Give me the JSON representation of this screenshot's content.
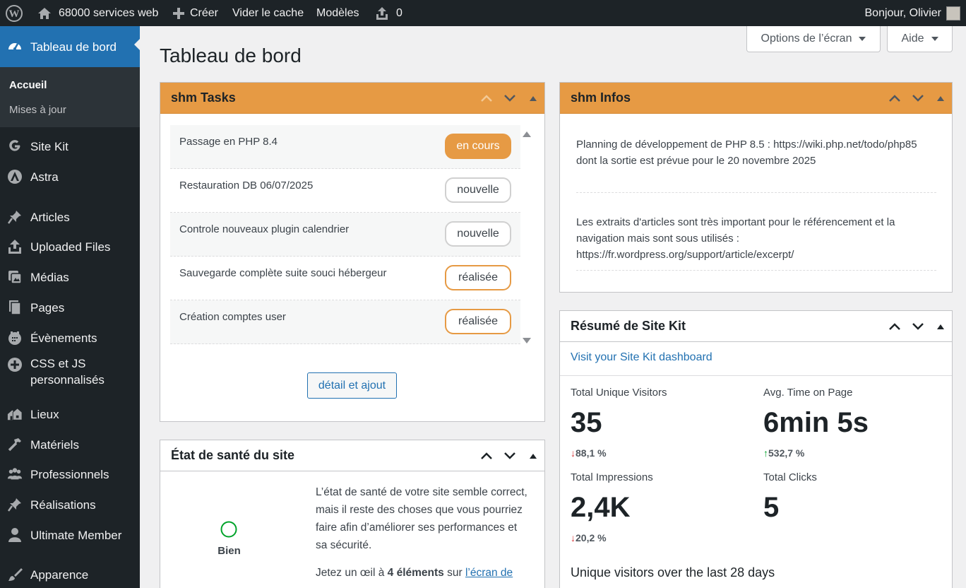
{
  "adminbar": {
    "site_name": "68000 services web",
    "create_label": "Créer",
    "clear_cache_label": "Vider le cache",
    "templates_label": "Modèles",
    "updates_count": "0",
    "greeting": "Bonjour, Olivier"
  },
  "sidebar": {
    "dashboard_label": "Tableau de bord",
    "submenu": [
      "Accueil",
      "Mises à jour"
    ],
    "items": [
      "Site Kit",
      "Astra",
      "Articles",
      "Uploaded Files",
      "Médias",
      "Pages",
      "Évènements",
      "CSS et JS personnalisés",
      "Lieux",
      "Matériels",
      "Professionnels",
      "Réalisations",
      "Ultimate Member",
      "Apparence"
    ]
  },
  "header": {
    "title": "Tableau de bord",
    "screen_options": "Options de l’écran",
    "help": "Aide"
  },
  "tasks": {
    "title": "shm Tasks",
    "items": [
      {
        "label": "Passage en PHP 8.4",
        "status": "en cours"
      },
      {
        "label": "Restauration DB 06/07/2025",
        "status": "nouvelle"
      },
      {
        "label": "Controle nouveaux plugin calendrier",
        "status": "nouvelle"
      },
      {
        "label": "Sauvegarde complète suite souci hébergeur",
        "status": "réalisée"
      },
      {
        "label": "Création comptes user",
        "status": "réalisée"
      }
    ],
    "button": "détail et ajout"
  },
  "health": {
    "title": "État de santé du site",
    "status": "Bien",
    "text": "L’état de santé de votre site semble correct, mais il reste des choses que vous pourriez faire afin d’améliorer ses performances et sa sécurité.",
    "look_a": "Jetez un œil à ",
    "look_b": "4 éléments",
    "look_c": " sur ",
    "link": "l’écran de"
  },
  "infos": {
    "title": "shm Infos",
    "items": [
      "Planning de développement de PHP 8.5 : https://wiki.php.net/todo/php85 dont la sortie est prévue pour le 20 novembre 2025",
      "Les extraits d'articles sont très important pour le référencement et la navigation mais sont sous utilisés : https://fr.wordpress.org/support/article/excerpt/"
    ]
  },
  "sitekit": {
    "title": "Résumé de Site Kit",
    "link": "Visit your Site Kit dashboard",
    "metrics": [
      {
        "label": "Total Unique Visitors",
        "value": "35",
        "change": "88,1 %",
        "dir": "down"
      },
      {
        "label": "Avg. Time on Page",
        "value": "6min 5s",
        "change": "532,7 %",
        "dir": "up"
      },
      {
        "label": "Total Impressions",
        "value": "2,4K",
        "change": "20,2 %",
        "dir": "down"
      },
      {
        "label": "Total Clicks",
        "value": "5",
        "change": "",
        "dir": ""
      }
    ],
    "subtitle": "Unique visitors over the last 28 days"
  },
  "colors": {
    "accent": "#2271b1",
    "box_header": "#e69a44",
    "status_good": "#00a32a",
    "arrow_down": "#d63638",
    "arrow_up": "#00a32a"
  }
}
